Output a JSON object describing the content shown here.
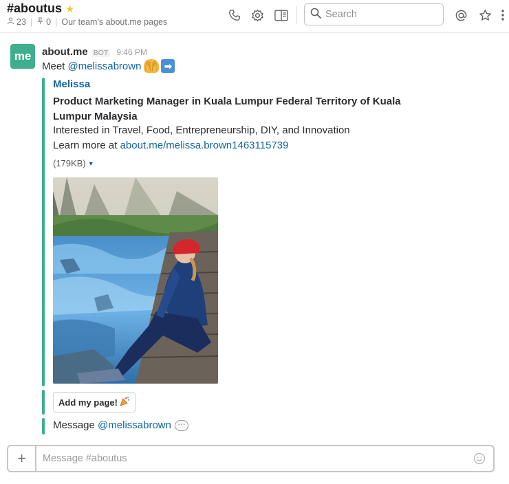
{
  "channel": {
    "name": "#aboutus",
    "members": "23",
    "pinned": "0",
    "topic": "Our team's about.me pages"
  },
  "search": {
    "placeholder": "Search"
  },
  "message": {
    "sender": "about.me",
    "badge": "BOT",
    "time": "9:46 PM",
    "avatar_text": "me",
    "text_prefix": "Meet ",
    "mention": "@melissabrown"
  },
  "attachment": {
    "title": "Melissa",
    "headline": "Product Marketing Manager in Kuala Lumpur Federal Territory of Kuala Lumpur Malaysia",
    "interests": "Interested in Travel, Food, Entrepreneurship, DIY, and Innovation",
    "learn_more_prefix": "Learn more at ",
    "learn_more_link": "about.me/melissa.brown1463115739",
    "size": "(179KB)"
  },
  "actions": {
    "add_button": "Add my page!",
    "message_prefix": "Message ",
    "message_mention": "@melissabrown"
  },
  "composer": {
    "placeholder": "Message #aboutus"
  },
  "colors": {
    "accent_green": "#3fae8f",
    "link_blue": "#1264a3",
    "star_yellow": "#f2c744"
  },
  "icons": [
    "star-icon",
    "person-icon",
    "pin-icon",
    "phone-icon",
    "gear-icon",
    "sidebar-toggle-icon",
    "search-icon",
    "at-icon",
    "star-outline-icon",
    "more-icon",
    "caret-down-icon",
    "raised-hands-emoji",
    "arrow-right-emoji",
    "party-popper-emoji",
    "speech-bubble-emoji",
    "plus-icon",
    "smiley-icon"
  ]
}
